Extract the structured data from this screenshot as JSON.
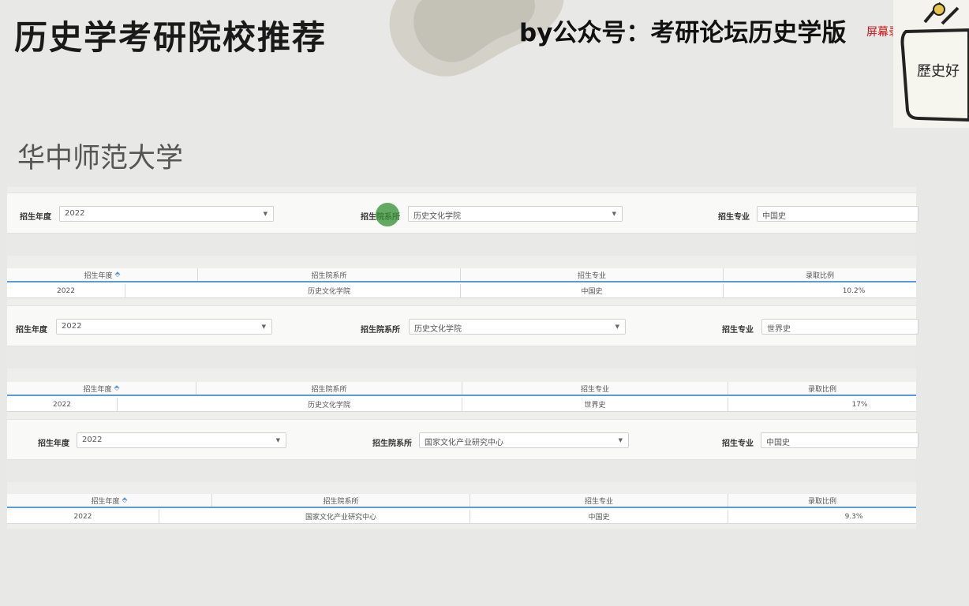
{
  "header": {
    "title": "历史学考研院校推荐",
    "byline": "by公众号：考研论坛历史学版",
    "watermark": "屏幕录像专家 未",
    "logo_text": "歷史好"
  },
  "school": {
    "name": "华中师范大学"
  },
  "colors": {
    "header_underline": "#5b9bd5",
    "cursor": "#3c963c",
    "watermark": "#d01010"
  },
  "filters": [
    {
      "year_label": "招生年度",
      "year_value": "2022",
      "dept_label": "招生院系所",
      "dept_value": "历史文化学院",
      "major_label": "招生专业",
      "major_value": "中国史"
    },
    {
      "year_label": "招生年度",
      "year_value": "2022",
      "dept_label": "招生院系所",
      "dept_value": "历史文化学院",
      "major_label": "招生专业",
      "major_value": "世界史"
    },
    {
      "year_label": "招生年度",
      "year_value": "2022",
      "dept_label": "招生院系所",
      "dept_value": "国家文化产业研究中心",
      "major_label": "招生专业",
      "major_value": "中国史"
    }
  ],
  "tables": [
    {
      "columns": [
        "招生年度",
        "招生院系所",
        "招生专业",
        "录取比例"
      ],
      "row": [
        "2022",
        "历史文化学院",
        "中国史",
        "10.2%"
      ]
    },
    {
      "columns": [
        "招生年度",
        "招生院系所",
        "招生专业",
        "录取比例"
      ],
      "row": [
        "2022",
        "历史文化学院",
        "世界史",
        "17%"
      ]
    },
    {
      "columns": [
        "招生年度",
        "招生院系所",
        "招生专业",
        "录取比例"
      ],
      "row": [
        "2022",
        "国家文化产业研究中心",
        "中国史",
        "9.3%"
      ]
    }
  ]
}
